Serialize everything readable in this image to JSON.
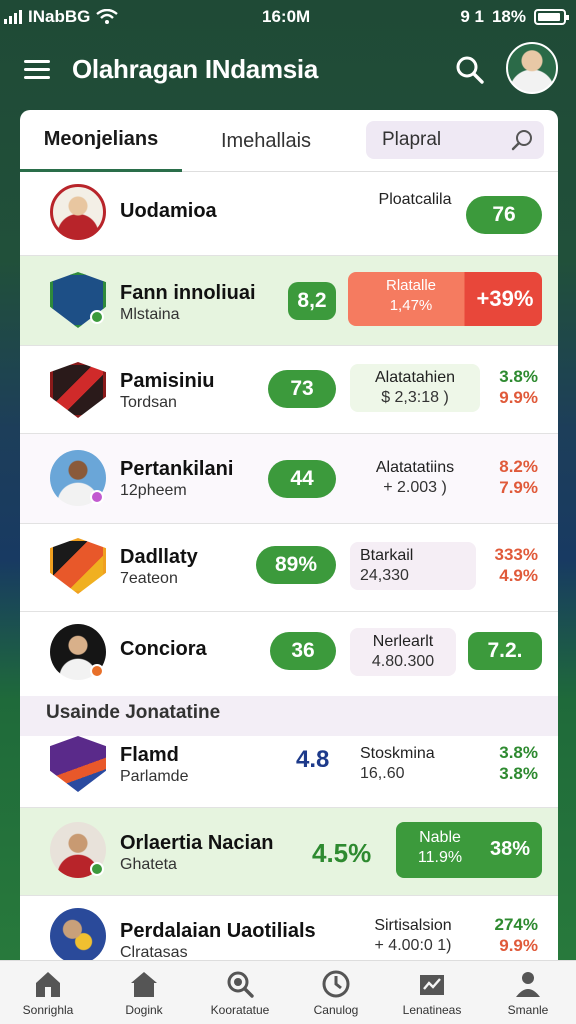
{
  "status_bar": {
    "carrier": "INabBG",
    "time": "16:0M",
    "extra": "9 1",
    "battery": "18%"
  },
  "header": {
    "title": "Olahragan INdamsia"
  },
  "tabs": [
    {
      "label": "Meonjelians"
    },
    {
      "label": "Imehallais"
    }
  ],
  "search": {
    "placeholder": "Plapral"
  },
  "rows": [
    {
      "name": "Uodamioa",
      "sub": "",
      "pill": "76",
      "info_1": "Ploatcalila",
      "info_2": "",
      "pct_1": "",
      "pct_2": ""
    },
    {
      "name": "Fann innoliuai",
      "sub": "Mlstaina",
      "pill": "8,2",
      "info_1": "Rlatalle",
      "info_2": "1,47%",
      "pct_1": "+39%",
      "pct_2": ""
    },
    {
      "name": "Pamisiniu",
      "sub": "Tordsan",
      "pill": "73",
      "info_1": "Alatatahien",
      "info_2": "$ 2,3:18 )",
      "pct_1": "3.8%",
      "pct_2": "9.9%"
    },
    {
      "name": "Pertankilani",
      "sub": "12pheem",
      "pill": "44",
      "info_1": "Alatatatiins",
      "info_2": "+ 2.003 )",
      "pct_1": "8.2%",
      "pct_2": "7.9%"
    },
    {
      "name": "Dadllaty",
      "sub": "7eateon",
      "pill": "89%",
      "info_1": "Btarkail",
      "info_2": "24,330",
      "pct_1": "333%",
      "pct_2": "4.9%"
    },
    {
      "name": "Conciora",
      "sub": "",
      "pill": "36",
      "info_1": "Nerlearlt",
      "info_2": "4.80.300",
      "pct_1": "7.2.",
      "pct_2": ""
    }
  ],
  "section_label": "Usainde Jonatatine",
  "rows2": [
    {
      "name": "Flamd",
      "sub": "Parlamde",
      "value": "4.8",
      "info_1": "Stoskmina",
      "info_2": "16,.60",
      "pct_1": "3.8%",
      "pct_2": "3.8%"
    },
    {
      "name": "Orlaertia Nacian",
      "sub": "Ghateta",
      "value": "4.5%",
      "info_1": "Nable",
      "info_2": "11.9%",
      "pct_1": "38%",
      "pct_2": ""
    },
    {
      "name": "Perdalaian Uaotilials",
      "sub": "Clratasas",
      "value": "",
      "info_1": "Sirtisalsion",
      "info_2": "+ 4.00:0 1)",
      "pct_1": "274%",
      "pct_2": "9.9%"
    }
  ],
  "bottom_nav": [
    {
      "label": "Sonrighla"
    },
    {
      "label": "Dogink"
    },
    {
      "label": "Kooratatue"
    },
    {
      "label": "Canulog"
    },
    {
      "label": "Lenatineas"
    },
    {
      "label": "Smanle"
    }
  ],
  "colors": {
    "brand_green": "#21503a",
    "pill_green": "#3c9a3c",
    "alert_red": "#e8473a",
    "light_green_row": "#e6f4df"
  }
}
